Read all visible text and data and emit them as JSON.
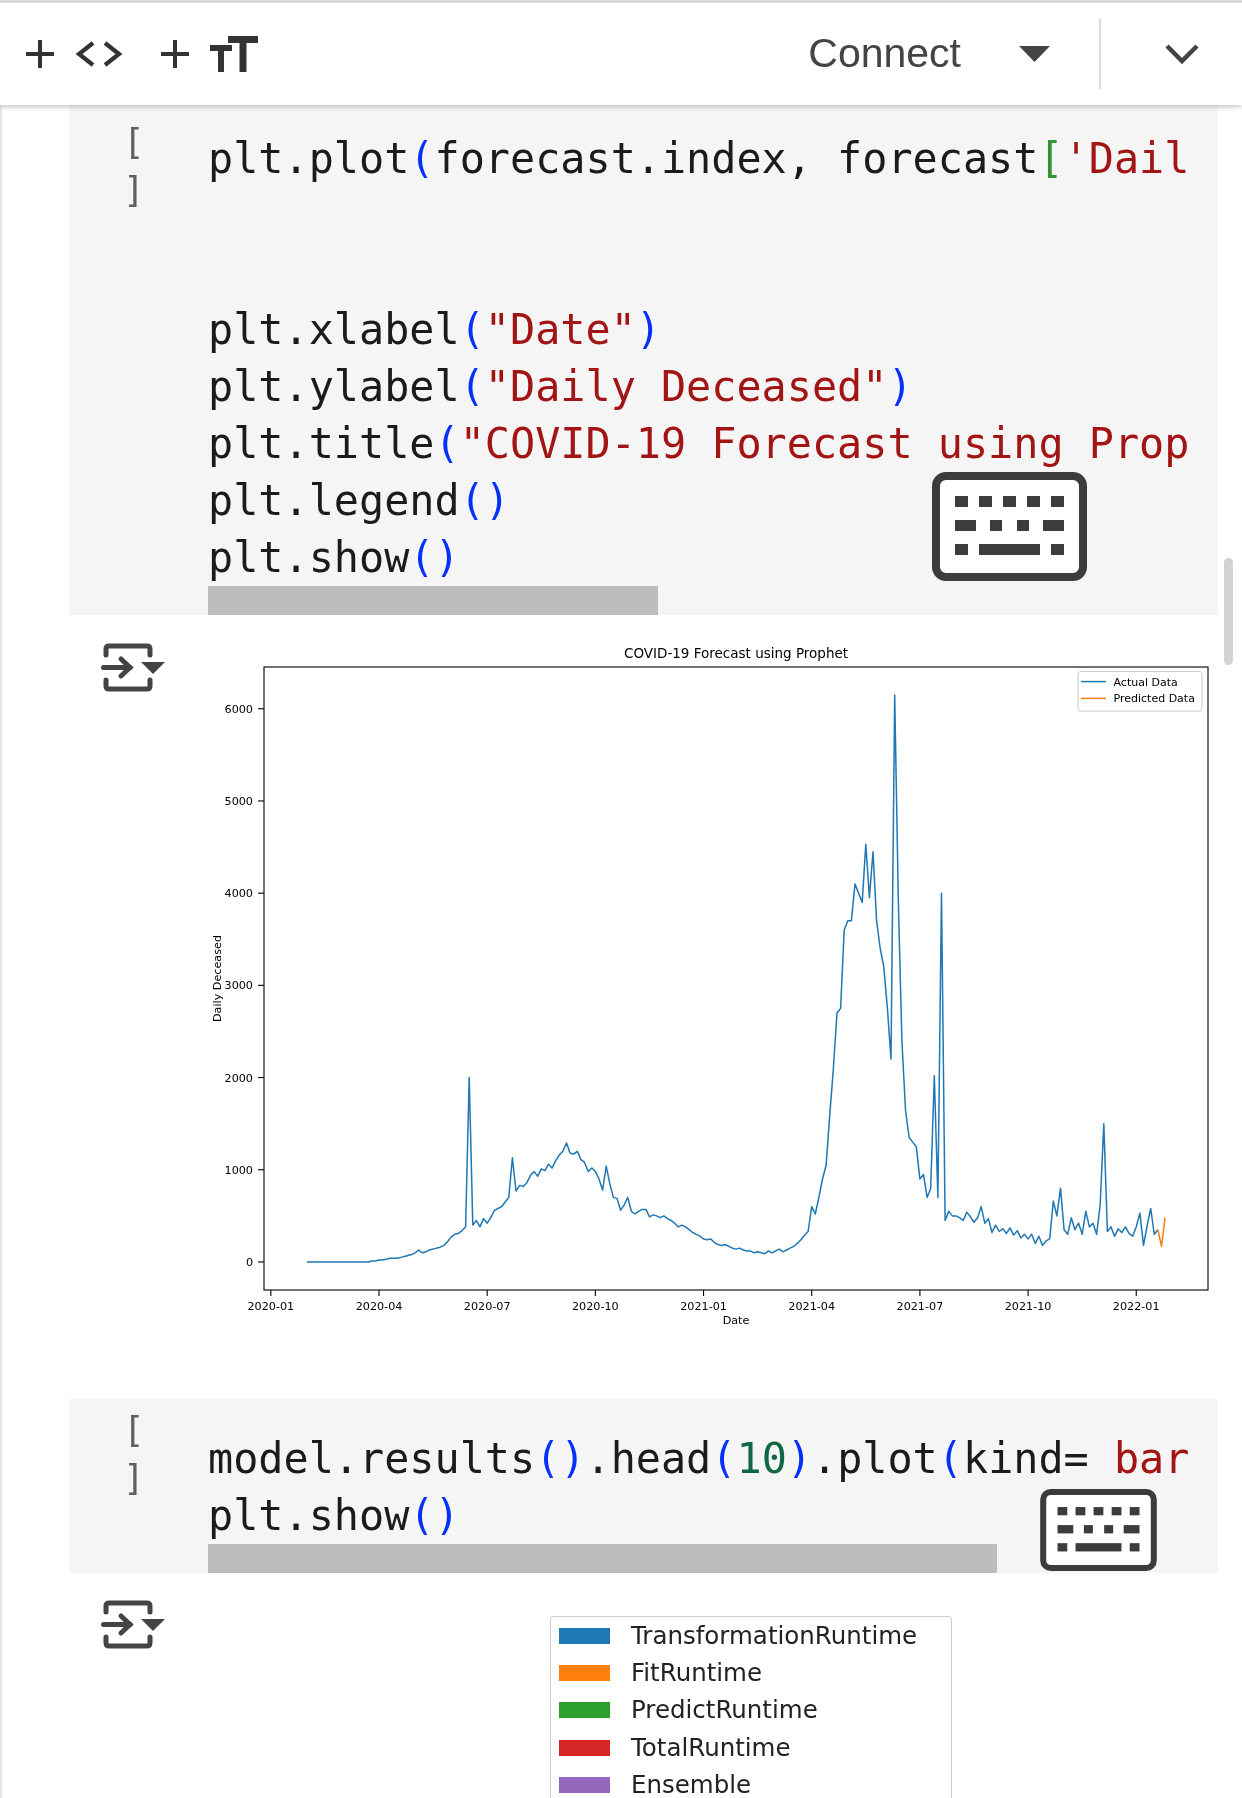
{
  "toolbar": {
    "connect_button": "Connect"
  },
  "cells": [
    {
      "kind": "code",
      "execution_count": "[ ]",
      "lines": [
        {
          "kind": "code",
          "tokens": [
            {
              "kind": "plain",
              "text": "plt.plot"
            },
            {
              "kind": "paren",
              "text": "("
            },
            {
              "kind": "plain",
              "text": "forecast.index, forecast"
            },
            {
              "kind": "bracket",
              "text": "["
            },
            {
              "kind": "string",
              "text": "'Dail"
            }
          ]
        },
        {
          "kind": "blank"
        },
        {
          "kind": "blank"
        },
        {
          "kind": "code",
          "tokens": [
            {
              "kind": "plain",
              "text": "plt.xlabel"
            },
            {
              "kind": "paren",
              "text": "("
            },
            {
              "kind": "string",
              "text": "\"Date\""
            },
            {
              "kind": "paren",
              "text": ")"
            }
          ]
        },
        {
          "kind": "code",
          "tokens": [
            {
              "kind": "plain",
              "text": "plt.ylabel"
            },
            {
              "kind": "paren",
              "text": "("
            },
            {
              "kind": "string",
              "text": "\"Daily Deceased\""
            },
            {
              "kind": "paren",
              "text": ")"
            }
          ]
        },
        {
          "kind": "code",
          "tokens": [
            {
              "kind": "plain",
              "text": "plt.title"
            },
            {
              "kind": "paren",
              "text": "("
            },
            {
              "kind": "string",
              "text": "\"COVID-19 Forecast using Prop"
            }
          ]
        },
        {
          "kind": "code",
          "tokens": [
            {
              "kind": "plain",
              "text": "plt.legend"
            },
            {
              "kind": "paren",
              "text": "()"
            }
          ]
        },
        {
          "kind": "code",
          "tokens": [
            {
              "kind": "plain",
              "text": "plt.show"
            },
            {
              "kind": "paren",
              "text": "()"
            }
          ]
        }
      ]
    },
    {
      "kind": "output",
      "chart_data": {
        "type": "line",
        "title": "COVID-19 Forecast using Prophet",
        "xlabel": "Date",
        "ylabel": "Daily Deceased",
        "legend": "upper right",
        "categories": [
          "2020-01",
          null,
          null,
          null,
          null,
          null,
          null,
          null,
          null,
          null,
          null,
          null,
          null,
          null,
          null,
          null,
          null,
          null,
          null,
          null,
          null,
          null,
          null,
          null,
          null,
          null,
          null,
          null,
          null,
          null,
          "2020-04",
          null,
          null,
          null,
          null,
          null,
          null,
          null,
          null,
          null,
          null,
          null,
          null,
          null,
          null,
          null,
          null,
          null,
          null,
          null,
          null,
          null,
          null,
          null,
          null,
          null,
          null,
          null,
          null,
          null,
          "2020-07",
          null,
          null,
          null,
          null,
          null,
          null,
          null,
          null,
          null,
          null,
          null,
          null,
          null,
          null,
          null,
          null,
          null,
          null,
          null,
          null,
          null,
          null,
          null,
          null,
          null,
          null,
          null,
          null,
          null,
          "2020-10",
          null,
          null,
          null,
          null,
          null,
          null,
          null,
          null,
          null,
          null,
          null,
          null,
          null,
          null,
          null,
          null,
          null,
          null,
          null,
          null,
          null,
          null,
          null,
          null,
          null,
          null,
          null,
          null,
          null,
          "2021-01",
          null,
          null,
          null,
          null,
          null,
          null,
          null,
          null,
          null,
          null,
          null,
          null,
          null,
          null,
          null,
          null,
          null,
          null,
          null,
          null,
          null,
          null,
          null,
          null,
          null,
          null,
          null,
          null,
          null,
          "2021-04",
          null,
          null,
          null,
          null,
          null,
          null,
          null,
          null,
          null,
          null,
          null,
          null,
          null,
          null,
          null,
          null,
          null,
          null,
          null,
          null,
          null,
          null,
          null,
          null,
          null,
          null,
          null,
          null,
          null,
          "2021-07",
          null,
          null,
          null,
          null,
          null,
          null,
          null,
          null,
          null,
          null,
          null,
          null,
          null,
          null,
          null,
          null,
          null,
          null,
          null,
          null,
          null,
          null,
          null,
          null,
          null,
          null,
          null,
          null,
          null,
          "2021-10",
          null,
          null,
          null,
          null,
          null,
          null,
          null,
          null,
          null,
          null,
          null,
          null,
          null,
          null,
          null,
          null,
          null,
          null,
          null,
          null,
          null,
          null,
          null,
          null,
          null,
          null,
          null,
          null,
          null,
          "2022-01",
          null,
          null,
          null,
          null,
          null,
          null,
          null,
          null
        ],
        "series": [
          {
            "name": "Actual Data",
            "color": "#1f77b4",
            "values": [
              null,
              null,
              null,
              null,
              null,
              null,
              null,
              null,
              null,
              null,
              0,
              0,
              0,
              0,
              0,
              0,
              0,
              0,
              0,
              0,
              0,
              0,
              0,
              0,
              0,
              0,
              0,
              0,
              10,
              10,
              20,
              20,
              30,
              40,
              40,
              40,
              50,
              60,
              70,
              80,
              100,
              130,
              100,
              110,
              130,
              140,
              150,
              160,
              180,
              220,
              270,
              300,
              310,
              340,
              380,
              2000,
              400,
              450,
              380,
              470,
              420,
              480,
              560,
              580,
              600,
              650,
              700,
              1130,
              770,
              830,
              820,
              860,
              940,
              980,
              930,
              1010,
              990,
              1060,
              1020,
              1100,
              1160,
              1200,
              1290,
              1180,
              1170,
              1200,
              1110,
              1080,
              980,
              1020,
              980,
              900,
              780,
              1040,
              850,
              700,
              690,
              560,
              620,
              700,
              550,
              520,
              550,
              570,
              570,
              490,
              510,
              500,
              480,
              500,
              470,
              450,
              420,
              380,
              400,
              380,
              350,
              320,
              300,
              280,
              250,
              240,
              250,
              210,
              190,
              180,
              190,
              170,
              150,
              140,
              150,
              130,
              120,
              120,
              100,
              110,
              100,
              90,
              120,
              100,
              120,
              140,
              110,
              130,
              150,
              170,
              200,
              240,
              290,
              330,
              600,
              520,
              700,
              900,
              1050,
              1600,
              2100,
              2700,
              2750,
              3600,
              3700,
              3700,
              4100,
              4000,
              3900,
              4530,
              3950,
              4450,
              3700,
              3400,
              3200,
              2750,
              2200,
              6150,
              3930,
              2400,
              1650,
              1350,
              1300,
              1250,
              900,
              950,
              700,
              800,
              2020,
              700,
              4000,
              450,
              550,
              500,
              500,
              480,
              450,
              540,
              490,
              430,
              480,
              600,
              420,
              470,
              320,
              400,
              330,
              360,
              310,
              370,
              290,
              340,
              260,
              300,
              250,
              300,
              200,
              280,
              180,
              230,
              250,
              660,
              500,
              800,
              350,
              300,
              480,
              350,
              420,
              300,
              550,
              380,
              420,
              300,
              620,
              1500,
              330,
              380,
              280,
              360,
              320,
              380,
              310,
              280,
              380,
              530,
              180,
              390,
              580,
              300,
              350,
              null,
              null
            ]
          },
          {
            "name": "Predicted Data",
            "color": "#ff7f0e",
            "values": [
              null,
              null,
              null,
              null,
              null,
              null,
              null,
              null,
              null,
              null,
              null,
              null,
              null,
              null,
              null,
              null,
              null,
              null,
              null,
              null,
              null,
              null,
              null,
              null,
              null,
              null,
              null,
              null,
              null,
              null,
              null,
              null,
              null,
              null,
              null,
              null,
              null,
              null,
              null,
              null,
              null,
              null,
              null,
              null,
              null,
              null,
              null,
              null,
              null,
              null,
              null,
              null,
              null,
              null,
              null,
              null,
              null,
              null,
              null,
              null,
              null,
              null,
              null,
              null,
              null,
              null,
              null,
              null,
              null,
              null,
              null,
              null,
              null,
              null,
              null,
              null,
              null,
              null,
              null,
              null,
              null,
              null,
              null,
              null,
              null,
              null,
              null,
              null,
              null,
              null,
              null,
              null,
              null,
              null,
              null,
              null,
              null,
              null,
              null,
              null,
              null,
              null,
              null,
              null,
              null,
              null,
              null,
              null,
              null,
              null,
              null,
              null,
              null,
              null,
              null,
              null,
              null,
              null,
              null,
              null,
              null,
              null,
              null,
              null,
              null,
              null,
              null,
              null,
              null,
              null,
              null,
              null,
              null,
              null,
              null,
              null,
              null,
              null,
              null,
              null,
              null,
              null,
              null,
              null,
              null,
              null,
              null,
              null,
              null,
              null,
              null,
              null,
              null,
              null,
              null,
              null,
              null,
              null,
              null,
              null,
              null,
              null,
              null,
              null,
              null,
              null,
              null,
              null,
              null,
              null,
              null,
              null,
              null,
              null,
              null,
              null,
              null,
              null,
              null,
              null,
              null,
              null,
              null,
              null,
              null,
              null,
              null,
              null,
              null,
              null,
              null,
              null,
              null,
              null,
              null,
              null,
              null,
              null,
              null,
              null,
              null,
              null,
              null,
              null,
              null,
              null,
              null,
              null,
              null,
              null,
              null,
              null,
              null,
              null,
              null,
              null,
              null,
              null,
              null,
              null,
              null,
              null,
              null,
              null,
              null,
              null,
              null,
              null,
              null,
              null,
              null,
              null,
              null,
              null,
              null,
              null,
              null,
              null,
              null,
              null,
              null,
              null,
              null,
              null,
              null,
              null,
              350,
              170,
              480
            ]
          }
        ],
        "ylim": [
          -304,
          6453
        ],
        "yticks": [
          0,
          1000,
          2000,
          3000,
          4000,
          5000,
          6000
        ]
      }
    },
    {
      "kind": "code",
      "execution_count": "[ ]",
      "lines": [
        {
          "kind": "code",
          "tokens": [
            {
              "kind": "plain",
              "text": "model.results"
            },
            {
              "kind": "paren",
              "text": "()"
            },
            {
              "kind": "plain",
              "text": ".head"
            },
            {
              "kind": "paren",
              "text": "("
            },
            {
              "kind": "number",
              "text": "10"
            },
            {
              "kind": "paren",
              "text": ")"
            },
            {
              "kind": "plain",
              "text": ".plot"
            },
            {
              "kind": "paren",
              "text": "("
            },
            {
              "kind": "plain",
              "text": "kind= "
            },
            {
              "kind": "string",
              "text": "bar"
            }
          ]
        },
        {
          "kind": "code",
          "tokens": [
            {
              "kind": "plain",
              "text": "plt.show"
            },
            {
              "kind": "paren",
              "text": "()"
            }
          ]
        }
      ]
    },
    {
      "kind": "output",
      "legend": [
        {
          "label": "TransformationRuntime",
          "color": "#1f77b4"
        },
        {
          "label": "FitRuntime",
          "color": "#ff7f0e"
        },
        {
          "label": "PredictRuntime",
          "color": "#2ca02c"
        },
        {
          "label": "TotalRuntime",
          "color": "#d62728"
        },
        {
          "label": "Ensemble",
          "color": "#9467bd"
        }
      ]
    }
  ]
}
